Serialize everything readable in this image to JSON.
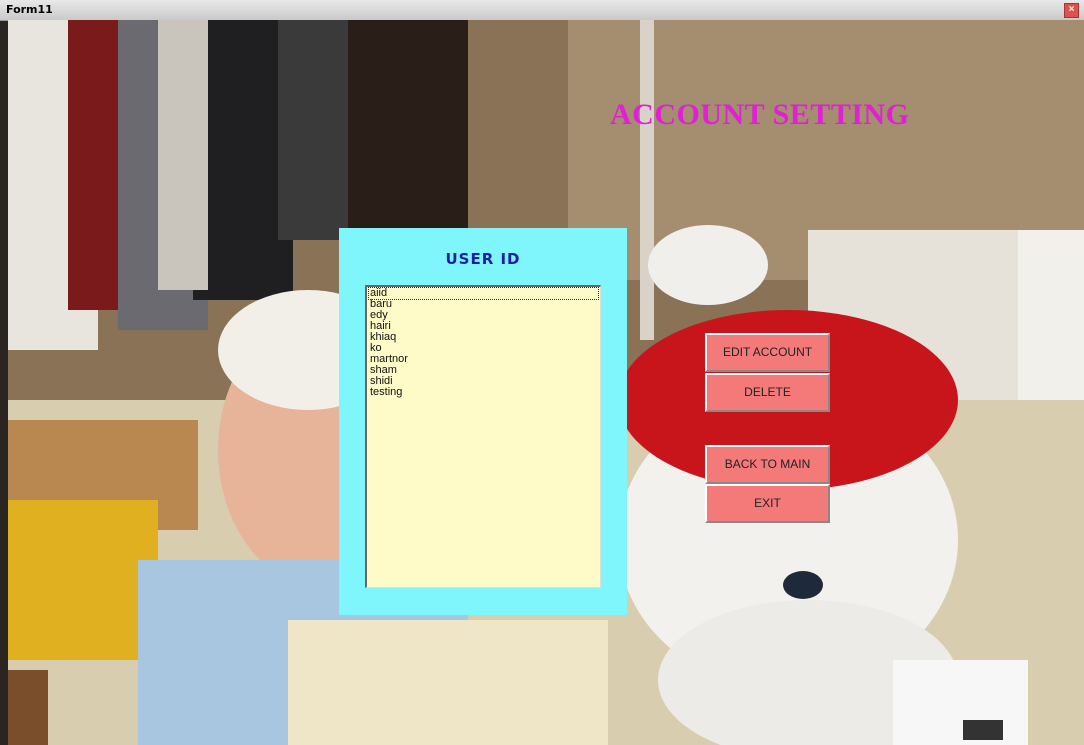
{
  "window": {
    "title": "Form11",
    "close_label": "×"
  },
  "heading": "ACCOUNT SETTING",
  "user_panel": {
    "title": "USER ID",
    "items": [
      "aiid",
      "baru",
      "edy",
      "hairi",
      "khiaq",
      "ko",
      "martnor",
      "sham",
      "shidi",
      "testing"
    ],
    "selected_index": 0
  },
  "buttons": {
    "edit_account": "EDIT ACCOUNT",
    "delete": "DELETE",
    "back": "BACK TO MAIN PAGE",
    "exit": "EXIT"
  },
  "colors": {
    "heading": "#e01fd6",
    "panel": "#7ff6fb",
    "listbox": "#fffbc8",
    "button": "#f47a7a",
    "panel_title": "#1a1fa8"
  }
}
